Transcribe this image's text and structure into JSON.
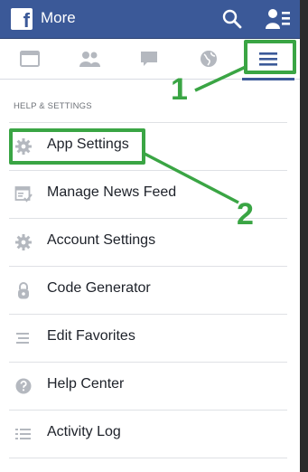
{
  "topbar": {
    "logo_letter": "f",
    "title": "More",
    "search_icon": "search-icon",
    "friends_icon": "friend-requests-icon"
  },
  "tabs": [
    {
      "icon": "news-feed-icon"
    },
    {
      "icon": "friends-icon"
    },
    {
      "icon": "messages-icon"
    },
    {
      "icon": "globe-icon"
    },
    {
      "icon": "menu-icon",
      "active": true
    }
  ],
  "menu": {
    "section_header": "HELP & SETTINGS",
    "items": [
      {
        "icon": "gear-icon",
        "label": "App Settings"
      },
      {
        "icon": "news-feed-settings-icon",
        "label": "Manage News Feed"
      },
      {
        "icon": "gear-icon",
        "label": "Account Settings"
      },
      {
        "icon": "lock-icon",
        "label": "Code Generator"
      },
      {
        "icon": "list-icon",
        "label": "Edit Favorites"
      },
      {
        "icon": "help-icon",
        "label": "Help Center"
      },
      {
        "icon": "activity-log-icon",
        "label": "Activity Log"
      }
    ]
  },
  "annotations": {
    "step_1": "1",
    "step_2": "2",
    "color": "#3aa544"
  },
  "colors": {
    "brand": "#3b5998",
    "icon_gray": "#b4b8bf"
  }
}
